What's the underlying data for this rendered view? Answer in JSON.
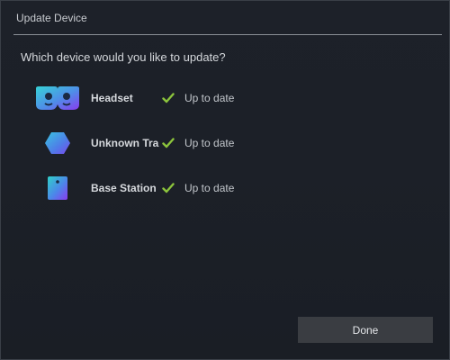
{
  "dialog": {
    "title": "Update Device",
    "prompt": "Which device would you like to update?",
    "done_label": "Done"
  },
  "devices": [
    {
      "name": "Headset",
      "icon": "headset-icon",
      "status": "Up to date",
      "status_icon": "checkmark-icon"
    },
    {
      "name": "Unknown Tra",
      "icon": "hexagon-tracker-icon",
      "status": "Up to date",
      "status_icon": "checkmark-icon"
    },
    {
      "name": "Base Station",
      "icon": "base-station-icon",
      "status": "Up to date",
      "status_icon": "checkmark-icon"
    }
  ],
  "colors": {
    "background": "#1c2028",
    "check_green": "#8cc43c",
    "button": "#3a3d42",
    "icon_gradient_start": "#3ac8d8",
    "icon_gradient_end": "#8a3cf0"
  }
}
